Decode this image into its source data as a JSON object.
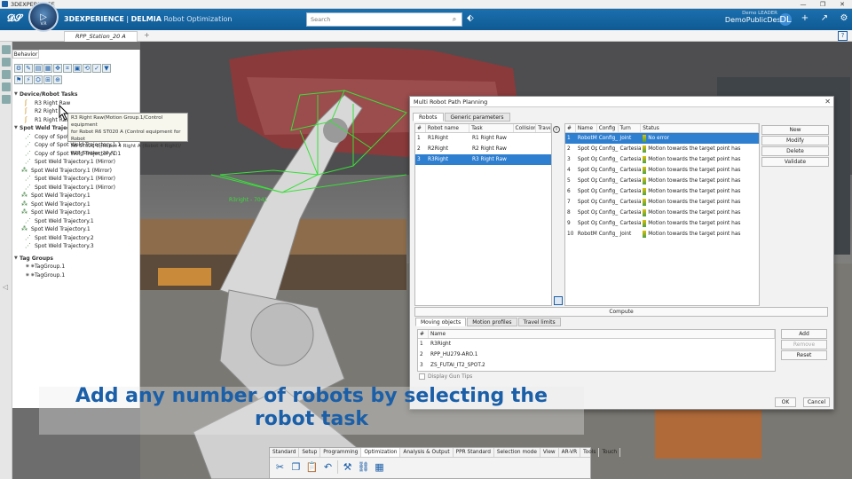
{
  "window": {
    "title": "3DEXPERIENCE",
    "controls": [
      "—",
      "❐",
      "✕"
    ]
  },
  "brand": {
    "platform": "3DEXPERIENCE",
    "separator": " | ",
    "product": "DELMIA",
    "app": "Robot Optimization",
    "compass_version": "V.R"
  },
  "search": {
    "placeholder": "Search"
  },
  "user": {
    "name_small": "Demo LEADER",
    "tenant": "DemoPublicDesign",
    "initials": "DL"
  },
  "tabs": [
    {
      "label": "RPP_Station_20 A"
    }
  ],
  "tree": {
    "tab_label": "Behavior",
    "groups": [
      {
        "label": "Device/Robot Tasks",
        "items": [
          "R3 Right Raw",
          "R2 Right",
          "R1 Right Raw"
        ]
      },
      {
        "label": "Spot Weld Trajectories",
        "items": [
          "Copy of Spot Weld Trajectory.1.1",
          "Copy of Spot Weld Trajectory.1.1",
          "Copy of Spot Weld Trajectory.1.1",
          "Spot Weld Trajectory.1 (Mirror)",
          "Spot Weld Trajectory.1 (Mirror)",
          "Spot Weld Trajectory.1 (Mirror)",
          "Spot Weld Trajectory.1 (Mirror)",
          "Spot Weld Trajectory.1",
          "Spot Weld Trajectory.1",
          "Spot Weld Trajectory.1",
          "Spot Weld Trajectory.1",
          "Spot Weld Trajectory.1",
          "Spot Weld Trajectory.2",
          "Spot Weld Trajectory.3"
        ]
      },
      {
        "label": "Tag Groups",
        "items": [
          "TagGroup.1",
          "TagGroup.1"
        ]
      }
    ],
    "tooltip": [
      "R3 Right Raw(Motion Group.1/Control equipment",
      "for Robot R6 ST020 A (Control equipment for Robot",
      "R6 ST020 1)/Robot 4 Right A (Robot 4 Right)/",
      "RPP_Station_20 A/)"
    ]
  },
  "dialog": {
    "title": "Multi Robot Path Planning",
    "tabs": [
      "Robots",
      "Generic parameters"
    ],
    "robots_columns": [
      "#",
      "Robot name",
      "Task",
      "Collision",
      "Travel"
    ],
    "robots": [
      {
        "n": "1",
        "name": "R1Right",
        "task": "R1 Right Raw"
      },
      {
        "n": "2",
        "name": "R2Right",
        "task": "R2 Right Raw"
      },
      {
        "n": "3",
        "name": "R3Right",
        "task": "R3 Right Raw"
      }
    ],
    "tasks_columns": [
      "#",
      "Name",
      "Config",
      "Turn",
      "Status"
    ],
    "tasks": [
      {
        "n": "1",
        "name": "RobotM",
        "config": "Config_",
        "turn": "",
        "type": "Joint",
        "status": "No error"
      },
      {
        "n": "2",
        "name": "Spot Op",
        "config": "Config_",
        "turn": "",
        "type": "Cartesia",
        "status": "Motion towards the target point has"
      },
      {
        "n": "3",
        "name": "Spot Op",
        "config": "Config_",
        "turn": "",
        "type": "Cartesia",
        "status": "Motion towards the target point has"
      },
      {
        "n": "4",
        "name": "Spot Op",
        "config": "Config_",
        "turn": "",
        "type": "Cartesia",
        "status": "Motion towards the target point has"
      },
      {
        "n": "5",
        "name": "Spot Op",
        "config": "Config_",
        "turn": "",
        "type": "Cartesia",
        "status": "Motion towards the target point has"
      },
      {
        "n": "6",
        "name": "Spot Op",
        "config": "Config_",
        "turn": "",
        "type": "Cartesia",
        "status": "Motion towards the target point has"
      },
      {
        "n": "7",
        "name": "Spot Op",
        "config": "Config_",
        "turn": "",
        "type": "Cartesia",
        "status": "Motion towards the target point has"
      },
      {
        "n": "8",
        "name": "Spot Op",
        "config": "Config_",
        "turn": "",
        "type": "Cartesia",
        "status": "Motion towards the target point has"
      },
      {
        "n": "9",
        "name": "Spot Op",
        "config": "Config_",
        "turn": "",
        "type": "Cartesia",
        "status": "Motion towards the target point has"
      },
      {
        "n": "10",
        "name": "RobotM",
        "config": "Config_",
        "turn": "",
        "type": "Joint",
        "status": "Motion towards the target point has"
      }
    ],
    "task_buttons": [
      "New",
      "Modify",
      "Delete",
      "Validate"
    ],
    "compute_label": "Compute",
    "lower_tabs": [
      "Moving objects",
      "Motion profiles",
      "Travel limits"
    ],
    "moving_columns": [
      "#",
      "Name"
    ],
    "moving_objects": [
      {
        "n": "1",
        "name": "R3Right"
      },
      {
        "n": "2",
        "name": "RPP_HU279-ARO.1"
      },
      {
        "n": "3",
        "name": "ZS_FUTAI_IT2_SPOT.2"
      }
    ],
    "moving_buttons": [
      "Add",
      "Remove",
      "Reset"
    ],
    "gun_tips_label": "Display Gun Tips",
    "ok_label": "OK",
    "cancel_label": "Cancel"
  },
  "caption": {
    "line1": "Add any number of robots by selecting the",
    "line2": "robot task"
  },
  "actionbar": {
    "tabs": [
      "Standard",
      "Setup",
      "Programming",
      "Optimization",
      "Analysis & Output",
      "PPR Standard",
      "Selection mode",
      "View",
      "AR-VR",
      "Tools",
      "Touch"
    ],
    "active_tab": "Optimization"
  },
  "viewport_label": "R3right - 7041"
}
